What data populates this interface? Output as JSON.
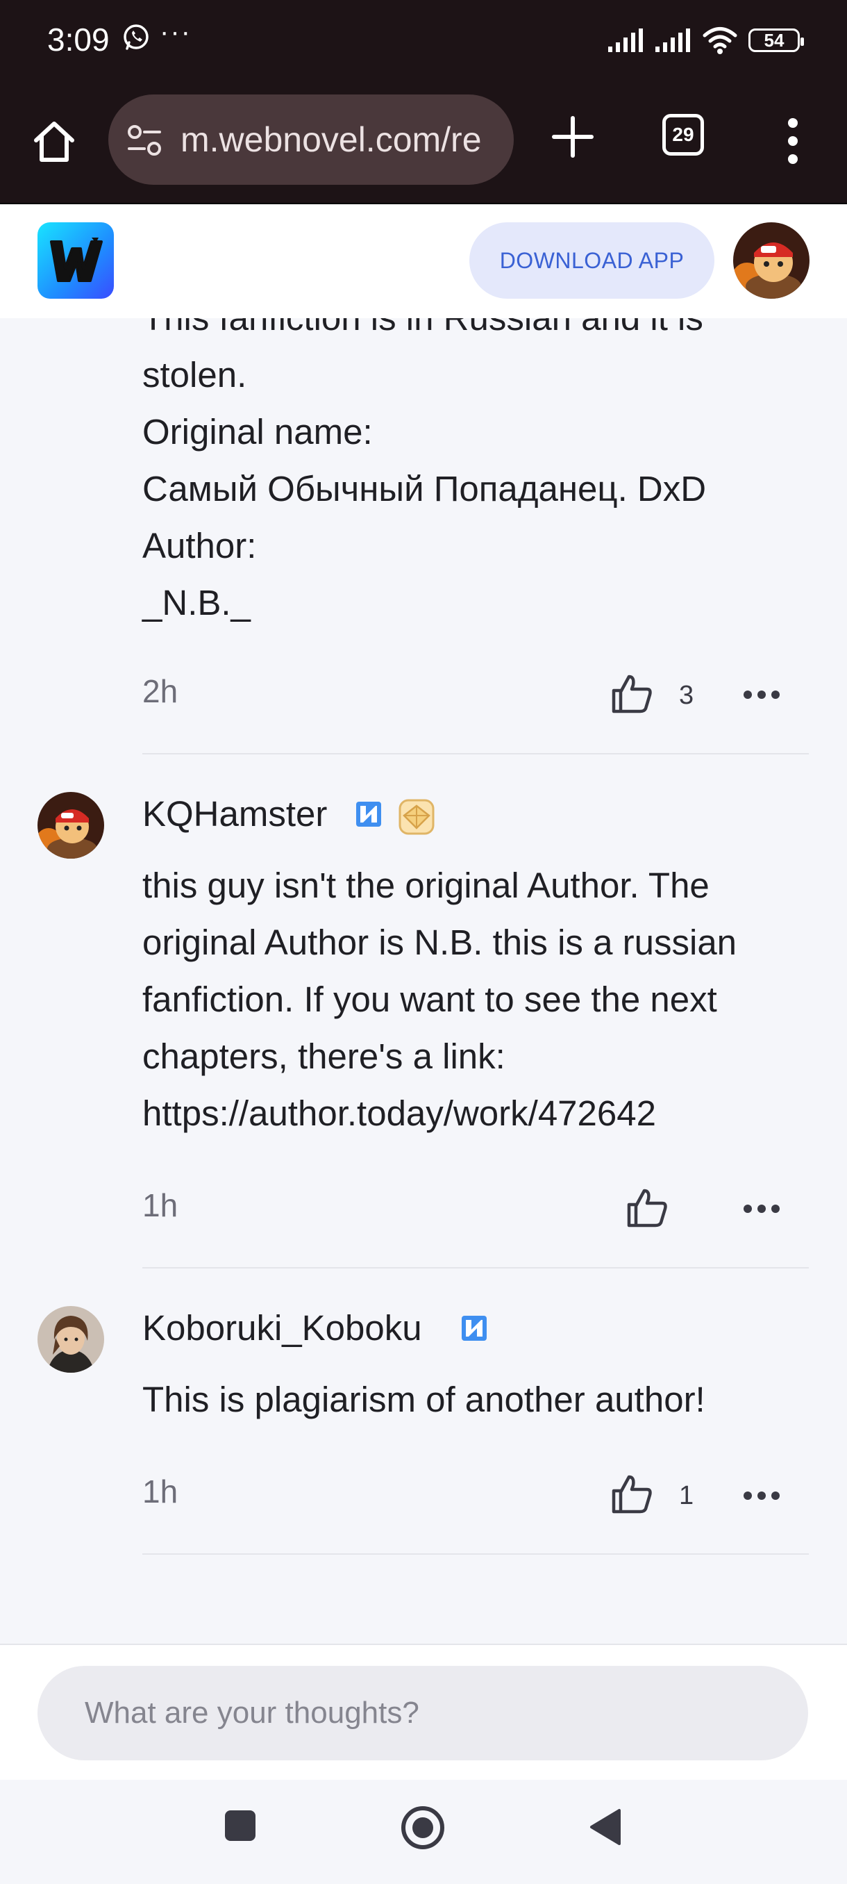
{
  "status_bar": {
    "time": "3:09",
    "overflow": "···",
    "battery": "54",
    "icons": [
      "whatsapp-icon",
      "signal-icon",
      "signal-icon",
      "wifi-icon",
      "battery-icon"
    ]
  },
  "browser": {
    "url": "m.webnovel.com/re",
    "tab_count": "29",
    "icons": [
      "home-icon",
      "site-settings-icon",
      "plus-icon",
      "tab-switcher-icon",
      "kebab-menu-icon"
    ]
  },
  "site_header": {
    "download_label": "DOWNLOAD APP",
    "logo_icon": "webnovel-logo-icon",
    "colors": {
      "download_text": "#3a61d4",
      "download_bg": "#e4e8fb"
    }
  },
  "comments": [
    {
      "username": "",
      "lines": [
        "This fanfiction is in Russian and it is",
        "stolen.",
        "Original name:",
        "Самый Обычный Попаданец. DxD",
        "Author:",
        "_N.B._"
      ],
      "time": "2h",
      "likes": "3"
    },
    {
      "username": "KQHamster",
      "lines": [
        "this guy isn't the original Author. The",
        "original Author is N.B. this is a russian",
        "fanfiction. If you want to see the next",
        "chapters, there's a link:",
        "https://author.today/work/472642"
      ],
      "time": "1h",
      "likes": ""
    },
    {
      "username": "Koboruki_Koboku",
      "lines": [
        "This is plagiarism of another author!"
      ],
      "time": "1h",
      "likes": "1"
    }
  ],
  "composer": {
    "placeholder": "What are your thoughts?"
  },
  "nav_bar": {
    "icons": [
      "recents-square-icon",
      "home-circle-icon",
      "back-triangle-icon"
    ]
  }
}
